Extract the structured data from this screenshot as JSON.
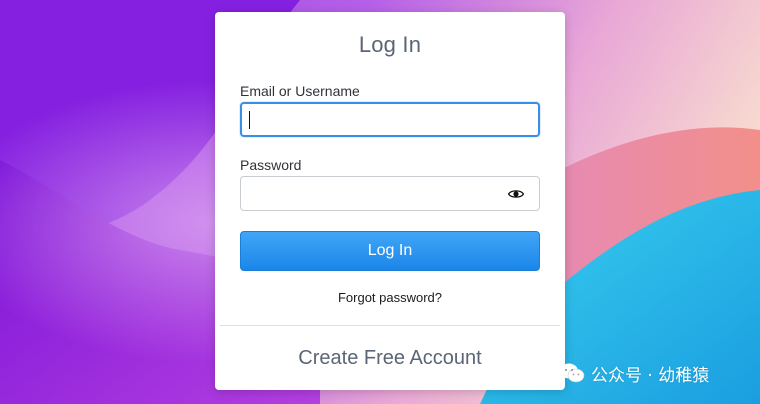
{
  "login": {
    "title": "Log In",
    "email_label": "Email or Username",
    "email_value": "",
    "password_label": "Password",
    "password_value": "",
    "submit_label": "Log In",
    "forgot_label": "Forgot password?",
    "create_label": "Create Free Account"
  },
  "watermark": {
    "text": "公众号 · 幼稚猿"
  },
  "colors": {
    "accent": "#1b86e9",
    "focus_border": "#3a8ee6",
    "muted_text": "#5b6675"
  },
  "icons": {
    "password_toggle": "eye-icon",
    "watermark": "wechat-icon"
  }
}
